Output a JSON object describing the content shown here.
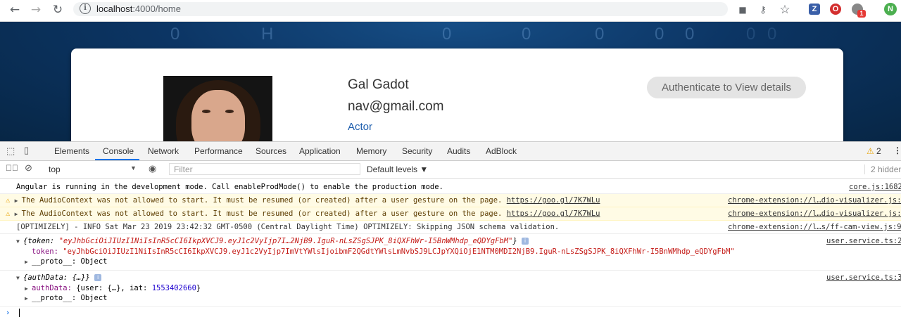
{
  "browser": {
    "url_host": "localhost",
    "url_path": ":4000/home",
    "profile_initial": "N",
    "extension_badge": "1"
  },
  "page": {
    "bg_digits": [
      "0",
      "H",
      "0",
      "0",
      "0",
      "0",
      "0",
      "0",
      "0"
    ],
    "profile": {
      "name": "Gal Gadot",
      "email": "nav@gmail.com",
      "role": "Actor"
    },
    "auth_button": "Authenticate to View details"
  },
  "devtools": {
    "tabs": [
      "Elements",
      "Console",
      "Network",
      "Performance",
      "Sources",
      "Application",
      "Memory",
      "Security",
      "Audits",
      "AdBlock"
    ],
    "active_tab": "Console",
    "warning_count": "2",
    "context": "top",
    "filter_placeholder": "Filter",
    "levels": "Default levels ▼",
    "hidden_count": "2 hidden",
    "messages": {
      "m1_text": "Angular is running in the development mode. Call enableProdMode() to enable the production mode.",
      "m1_src": "core.js:1682",
      "m2_text": "The AudioContext was not allowed to start. It must be resumed (or created) after a user gesture on the page. ",
      "m2_link": "https://goo.gl/7K7WLu",
      "m2_src": "chrome-extension://l…dio-visualizer.js:",
      "m3_text": "The AudioContext was not allowed to start. It must be resumed (or created) after a user gesture on the page. ",
      "m3_link": "https://goo.gl/7K7WLu",
      "m3_src": "chrome-extension://l…dio-visualizer.js:",
      "m4_text": "[OPTIMIZELY] - INFO Sat Mar 23 2019 23:42:32 GMT-0500 (Central Daylight Time) OPTIMIZELY: Skipping JSON schema validation.",
      "m4_src": "chrome-extension://l…s/ff-cam-view.js:9",
      "m5_head_key": "{token: ",
      "m5_head_val": "\"eyJhbGciOiJIUzI1NiIsInR5cCI6IkpXVCJ9.eyJ1c2VyIjp7I…2NjB9.IguR-nLsZSgSJPK_8iQXFhWr-I5BnWMhdp_eQDYgFbM\"",
      "m5_head_end": "}",
      "m5_token_key": "token: ",
      "m5_token_val": "\"eyJhbGciOiJIUzI1NiIsInR5cCI6IkpXVCJ9.eyJ1c2VyIjp7ImVtYWlsIjoibmF2QGdtYWlsLmNvbSJ9LCJpYXQiOjE1NTM0MDI2NjB9.IguR-nLsZSgSJPK_8iQXFhWr-I5BnWMhdp_eQDYgFbM\"",
      "m5_proto": "__proto__: Object",
      "m5_src": "user.service.ts:2",
      "m6_head": "{authData: {…}}",
      "m6_auth_key": "authData: ",
      "m6_auth_val": "{user: {…}, iat: ",
      "m6_auth_iat": "1553402660",
      "m6_auth_end": "}",
      "m6_proto": "__proto__: Object",
      "m6_src": "user.service.ts:3"
    },
    "prompt": "›"
  },
  "colors": {
    "accent": "#1a73e8",
    "warn_bg": "#fffbe5",
    "string": "#c41a16",
    "number": "#1c00cf"
  }
}
